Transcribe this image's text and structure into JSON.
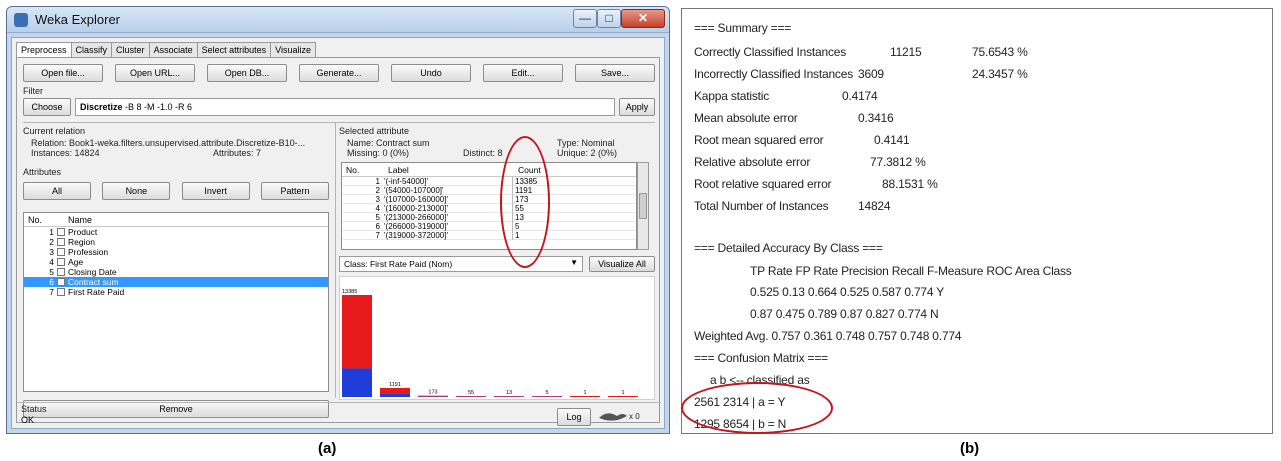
{
  "panel_a": {
    "window_title": "Weka Explorer",
    "window_controls": {
      "minimize": "—",
      "maximize": "□",
      "close": "✕"
    },
    "tabs": [
      "Preprocess",
      "Classify",
      "Cluster",
      "Associate",
      "Select attributes",
      "Visualize"
    ],
    "toolbar": [
      "Open file...",
      "Open URL...",
      "Open DB...",
      "Generate...",
      "Undo",
      "Edit...",
      "Save..."
    ],
    "filter": {
      "section_label": "Filter",
      "choose_label": "Choose",
      "filter_name": "Discretize",
      "filter_args": "-B 8 -M -1.0 -R 6",
      "apply_label": "Apply"
    },
    "current_relation": {
      "section_label": "Current relation",
      "relation": "Relation: Book1-weka.filters.unsupervised.attribute.Discretize-B10-...",
      "instances": "Instances: 14824",
      "attributes": "Attributes: 7"
    },
    "attributes": {
      "section_label": "Attributes",
      "buttons": [
        "All",
        "None",
        "Invert",
        "Pattern"
      ],
      "col_no": "No.",
      "col_name": "Name",
      "rows": [
        {
          "no": "1",
          "name": "Product"
        },
        {
          "no": "2",
          "name": "Region"
        },
        {
          "no": "3",
          "name": "Profession"
        },
        {
          "no": "4",
          "name": "Age"
        },
        {
          "no": "5",
          "name": "Closing Date"
        },
        {
          "no": "6",
          "name": "Contract sum"
        },
        {
          "no": "7",
          "name": "First Rate Paid"
        }
      ],
      "selected_row": "6",
      "remove_label": "Remove"
    },
    "selected_attribute": {
      "section_label": "Selected attribute",
      "name": "Name: Contract sum",
      "type": "Type: Nominal",
      "missing": "Missing: 0 (0%)",
      "distinct": "Distinct: 8",
      "unique": "Unique: 2 (0%)",
      "col_no": "No.",
      "col_label": "Label",
      "col_count": "Count",
      "rows": [
        {
          "no": "1",
          "label": "'(-inf-54000]'",
          "count": "13385"
        },
        {
          "no": "2",
          "label": "'(54000-107000]'",
          "count": "1191"
        },
        {
          "no": "3",
          "label": "'(107000-160000]'",
          "count": "173"
        },
        {
          "no": "4",
          "label": "'(160000-213000]'",
          "count": "55"
        },
        {
          "no": "5",
          "label": "'(213000-266000]'",
          "count": "13"
        },
        {
          "no": "6",
          "label": "'(266000-319000]'",
          "count": "5"
        },
        {
          "no": "7",
          "label": "'(319000-372000]'",
          "count": "1"
        }
      ]
    },
    "class_select": "Class: First Rate Paid (Nom)",
    "visualize_all_label": "Visualize All",
    "status_label": "Status",
    "status_value": "OK",
    "log_label": "Log",
    "worker_count": "x 0",
    "histogram": {
      "bins": [
        {
          "label": "13385",
          "total": 13385,
          "red_frac": 0.72
        },
        {
          "label": "1191",
          "total": 1191,
          "red_frac": 0.6
        },
        {
          "label": "173",
          "total": 173,
          "red_frac": 0.7
        },
        {
          "label": "55",
          "total": 55,
          "red_frac": 0.7
        },
        {
          "label": "13",
          "total": 13,
          "red_frac": 0.7
        },
        {
          "label": "5",
          "total": 5,
          "red_frac": 0.7
        },
        {
          "label": "1",
          "total": 1,
          "red_frac": 1.0
        },
        {
          "label": "1",
          "total": 1,
          "red_frac": 1.0
        }
      ],
      "colors": {
        "class_a": "#e8191a",
        "class_b": "#1f3dd8"
      }
    },
    "caption": "(a)"
  },
  "panel_b": {
    "summary_header": "=== Summary ===",
    "summary": [
      {
        "label": "Correctly Classified Instances",
        "value": "11215",
        "pct": "75.6543 %"
      },
      {
        "label": "Incorrectly Classified Instances",
        "value": "3609",
        "pct": "24.3457 %"
      },
      {
        "label": "Kappa statistic",
        "value": "0.4174",
        "pct": ""
      },
      {
        "label": "Mean absolute error",
        "value": "0.3416",
        "pct": ""
      },
      {
        "label": "Root mean squared error",
        "value": "0.4141",
        "pct": ""
      },
      {
        "label": "Relative absolute error",
        "value": "77.3812 %",
        "pct": ""
      },
      {
        "label": "Root relative squared error",
        "value": "88.1531 %",
        "pct": ""
      },
      {
        "label": "Total Number of Instances",
        "value": "14824",
        "pct": ""
      }
    ],
    "detail_header": "=== Detailed Accuracy By Class ===",
    "detail_columns": "TP Rate   FP Rate   Precision   Recall   F-Measure   ROC Area   Class",
    "detail_rows": [
      "0.525    0.13     0.664    0.525    0.587    0.774    Y",
      "0.87     0.475    0.789    0.87     0.827    0.774    N",
      "Weighted Avg.    0.757    0.361    0.748    0.757    0.748    0.774"
    ],
    "confusion_header": "=== Confusion Matrix ===",
    "confusion_columns": "a    b   <-- classified as",
    "confusion_rows": [
      "2561 2314 |    a = Y",
      "1295 8654 |    b = N"
    ],
    "caption": "(b)"
  }
}
